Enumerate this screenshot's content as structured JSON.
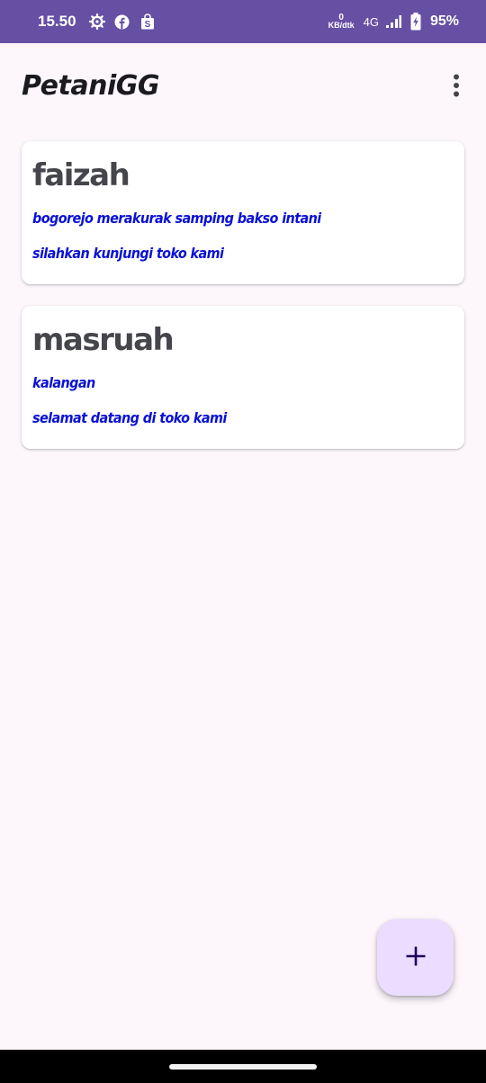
{
  "status_bar": {
    "time": "15.50",
    "left_icons": [
      "settings-gear-icon",
      "facebook-icon",
      "shopping-bag-icon"
    ],
    "net_speed_value": "0",
    "net_speed_unit": "KB/dtk",
    "network_type": "4G",
    "battery_percent": "95%"
  },
  "app_bar": {
    "title": "PetaniGG",
    "overflow_icon": "more-vert-icon"
  },
  "stores": [
    {
      "name": "faizah",
      "address": "bogorejo merakurak samping bakso intani",
      "description": "silahkan kunjungi toko kami"
    },
    {
      "name": "masruah",
      "address": "kalangan",
      "description": "selamat datang di toko kami"
    }
  ],
  "fab": {
    "icon": "add-icon"
  },
  "colors": {
    "status_bar": "#6650a4",
    "background": "#fdf7fc",
    "card_name": "#45454c",
    "card_text": "#0a12d6",
    "fab": "#eaddff",
    "fab_icon": "#21005d"
  }
}
